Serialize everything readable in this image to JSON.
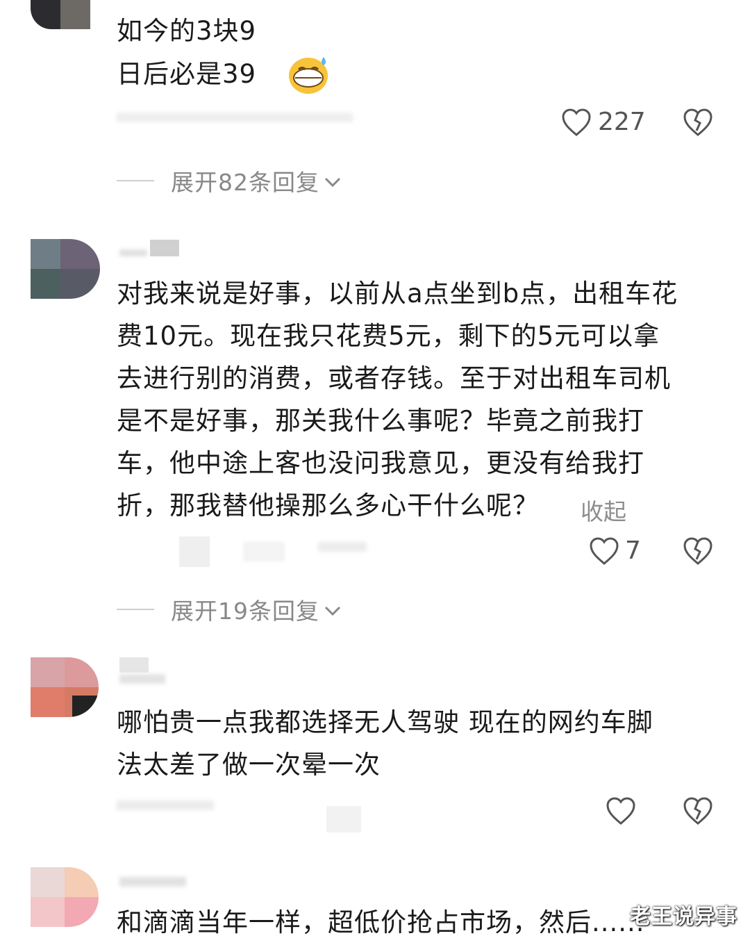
{
  "comments": [
    {
      "lines": [
        "如今的3块9",
        "日后必是39"
      ],
      "emoji": "grinning-sweat-emoji",
      "likes": "227",
      "expand_label": "展开82条回复"
    },
    {
      "lines": [
        "对我来说是好事，以前从a点坐到b点，出租车花",
        "费10元。现在我只花费5元，剩下的5元可以拿",
        "去进行别的消费，或者存钱。至于对出租车司机",
        "是不是好事，那关我什么事呢？毕竟之前我打",
        "车，他中途上客也没问我意见，更没有给我打",
        "折，那我替他操那么多心干什么呢？"
      ],
      "collapse_label": "收起",
      "likes": "7",
      "expand_label": "展开19条回复"
    },
    {
      "lines": [
        "哪怕贵一点我都选择无人驾驶  现在的网约车脚",
        "法太差了做一次晕一次"
      ],
      "likes": ""
    },
    {
      "lines": [
        "和滴滴当年一样，超低价抢占市场，然后......"
      ]
    }
  ],
  "watermark": "老王说异事",
  "colors": {
    "text": "#1a1a1a",
    "muted": "#888888",
    "icon": "#555555"
  }
}
